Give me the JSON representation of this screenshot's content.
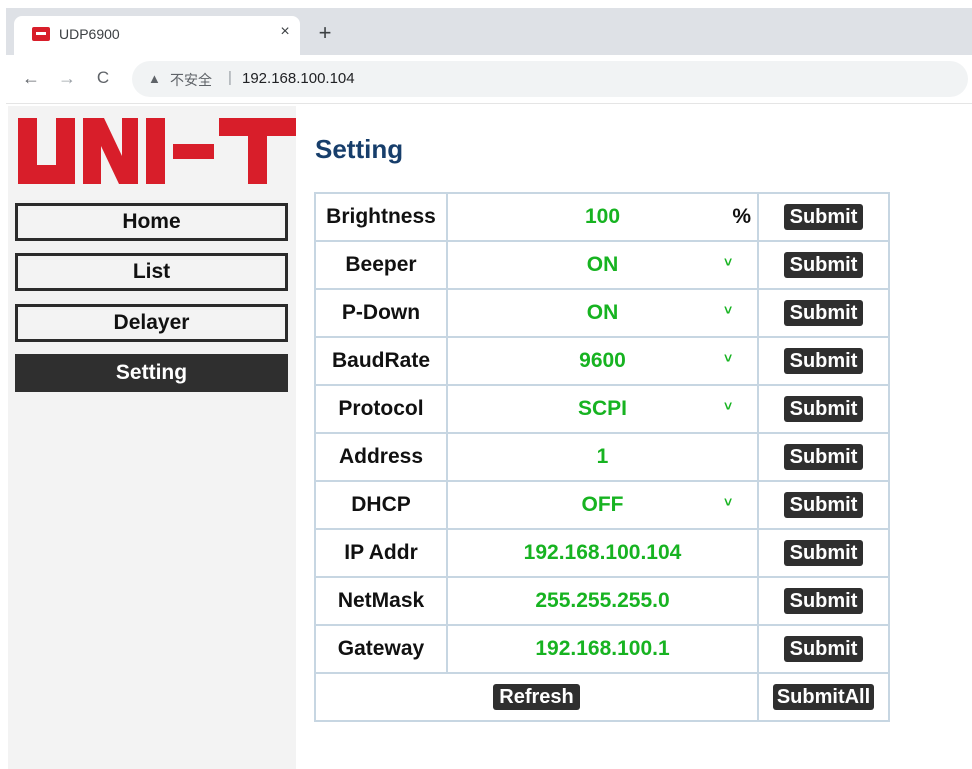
{
  "browser": {
    "tab_title": "UDP6900",
    "tab_close": "×",
    "new_tab": "+",
    "back": "←",
    "forward": "→",
    "reload": "C",
    "security_warning": "▲",
    "security_label": "不安全",
    "separator": "|",
    "url": "192.168.100.104"
  },
  "logo": {
    "text": "UNI-T",
    "color": "#d81e2a"
  },
  "sidebar": {
    "items": [
      {
        "label": "Home",
        "active": false
      },
      {
        "label": "List",
        "active": false
      },
      {
        "label": "Delayer",
        "active": false
      },
      {
        "label": "Setting",
        "active": true
      }
    ]
  },
  "main": {
    "title": "Setting",
    "rows": [
      {
        "label": "Brightness",
        "value": "100",
        "unit": "%",
        "dropdown": false,
        "action": "Submit"
      },
      {
        "label": "Beeper",
        "value": "ON",
        "dropdown": true,
        "action": "Submit"
      },
      {
        "label": "P-Down",
        "value": "ON",
        "dropdown": true,
        "action": "Submit"
      },
      {
        "label": "BaudRate",
        "value": "9600",
        "dropdown": true,
        "action": "Submit"
      },
      {
        "label": "Protocol",
        "value": "SCPI",
        "dropdown": true,
        "action": "Submit"
      },
      {
        "label": "Address",
        "value": "1",
        "dropdown": false,
        "action": "Submit"
      },
      {
        "label": "DHCP",
        "value": "OFF",
        "dropdown": true,
        "action": "Submit"
      },
      {
        "label": "IP Addr",
        "value": "192.168.100.104",
        "dropdown": false,
        "action": "Submit"
      },
      {
        "label": "NetMask",
        "value": "255.255.255.0",
        "dropdown": false,
        "action": "Submit"
      },
      {
        "label": "Gateway",
        "value": "192.168.100.1",
        "dropdown": false,
        "action": "Submit"
      }
    ],
    "dropdown_caret": "˅",
    "refresh_label": "Refresh",
    "submit_all_label": "SubmitAll"
  },
  "colors": {
    "value_green": "#17b321",
    "title_blue": "#173e6b",
    "button_dark": "#2f2f2f",
    "cell_border": "#c7d6e2"
  }
}
